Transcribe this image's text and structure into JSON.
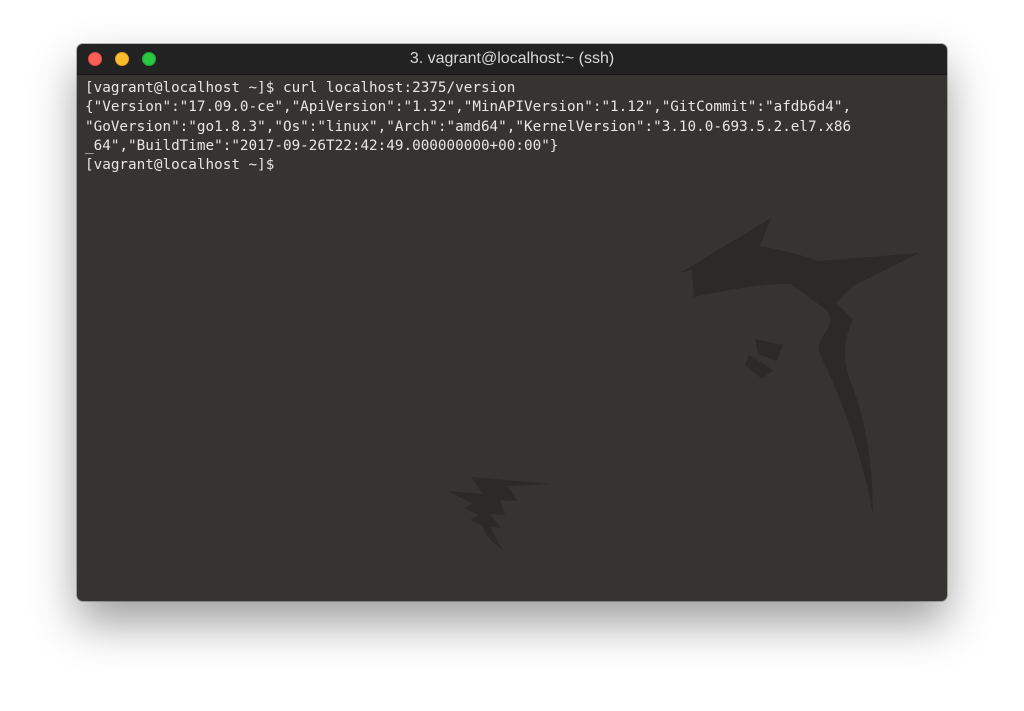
{
  "window": {
    "title": "3. vagrant@localhost:~ (ssh)"
  },
  "terminal": {
    "lines": [
      "[vagrant@localhost ~]$ curl localhost:2375/version",
      "{\"Version\":\"17.09.0-ce\",\"ApiVersion\":\"1.32\",\"MinAPIVersion\":\"1.12\",\"GitCommit\":\"afdb6d4\",",
      "\"GoVersion\":\"go1.8.3\",\"Os\":\"linux\",\"Arch\":\"amd64\",\"KernelVersion\":\"3.10.0-693.5.2.el7.x86",
      "_64\",\"BuildTime\":\"2017-09-26T22:42:49.000000000+00:00\"}",
      "[vagrant@localhost ~]$"
    ]
  },
  "colors": {
    "background": "#353431",
    "titlebar": "#222222",
    "text": "#e6e6e6",
    "close": "#fc5f57",
    "minimize": "#fdbc2e",
    "maximize": "#29c840",
    "watermark": "#2b2a28"
  },
  "icons": {
    "watermark": "kali-dragon-watermark-icon"
  }
}
